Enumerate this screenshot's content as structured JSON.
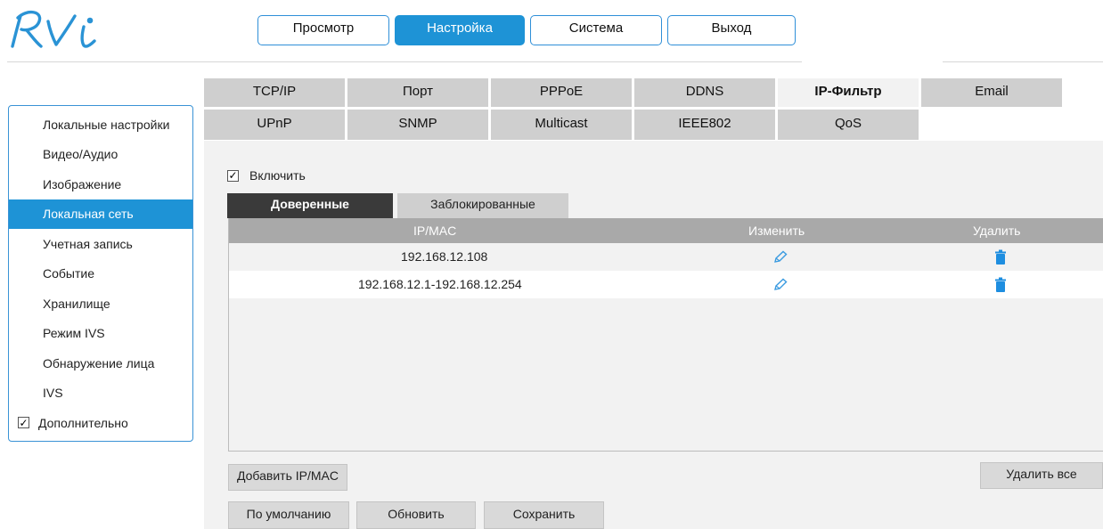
{
  "logo": {
    "text": "RVi",
    "color": "#2a93d5"
  },
  "topnav": {
    "items": [
      {
        "label": "Просмотр",
        "active": false
      },
      {
        "label": "Настройка",
        "active": true
      },
      {
        "label": "Система",
        "active": false
      },
      {
        "label": "Выход",
        "active": false
      }
    ]
  },
  "sidebar": {
    "items": [
      {
        "label": "Локальные настройки"
      },
      {
        "label": "Видео/Аудио"
      },
      {
        "label": "Изображение"
      },
      {
        "label": "Локальная сеть",
        "active": true
      },
      {
        "label": "Учетная запись"
      },
      {
        "label": "Событие"
      },
      {
        "label": "Хранилище"
      },
      {
        "label": "Режим IVS"
      },
      {
        "label": "Обнаружение лица"
      },
      {
        "label": "IVS"
      }
    ],
    "advanced": {
      "label": "Дополнительно",
      "checked": true
    }
  },
  "subtabs": {
    "row1": [
      "TCP/IP",
      "Порт",
      "PPPoE",
      "DDNS",
      "IP-Фильтр",
      "Email"
    ],
    "row2": [
      "UPnP",
      "SNMP",
      "Multicast",
      "IEEE802",
      "QoS"
    ],
    "active": "IP-Фильтр"
  },
  "enable": {
    "label": "Включить",
    "checked": true
  },
  "inner_tabs": {
    "trusted": "Доверенные",
    "blocked": "Заблокированные"
  },
  "table": {
    "headers": {
      "ipmac": "IP/MAC",
      "edit": "Изменить",
      "delete": "Удалить"
    },
    "rows": [
      {
        "ip": "192.168.12.108"
      },
      {
        "ip": "192.168.12.1-192.168.12.254"
      }
    ]
  },
  "buttons": {
    "add": "Добавить IP/MAC",
    "delete_all": "Удалить все",
    "default": "По умолчанию",
    "refresh": "Обновить",
    "save": "Сохранить"
  },
  "colors": {
    "accent": "#1e93d6",
    "header_gray": "#a9a9a9",
    "tab_gray": "#cfcfcf"
  }
}
